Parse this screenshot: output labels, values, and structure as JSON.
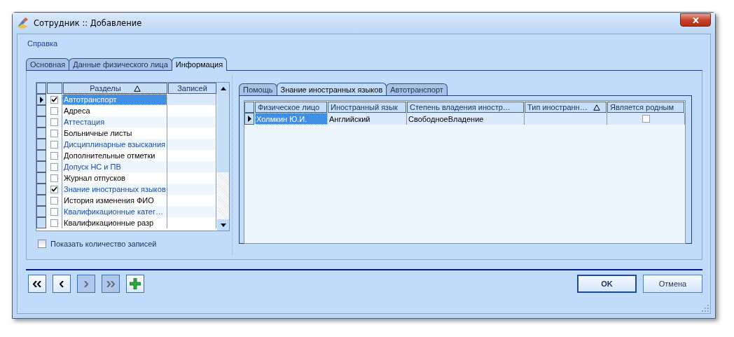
{
  "window": {
    "title": "Сотрудник :: Добавление"
  },
  "menu": [
    {
      "label": "Справка"
    }
  ],
  "tabs": [
    {
      "label": "Основная",
      "selected": false
    },
    {
      "label": "Данные физического лица",
      "selected": false
    },
    {
      "label": "Информация",
      "selected": true
    }
  ],
  "sections_grid": {
    "columns": [
      {
        "label": "Разделы",
        "sorted": true
      },
      {
        "label": "Записей",
        "sorted": false
      }
    ],
    "rows": [
      {
        "name": "Автотранспорт",
        "checked": true,
        "selected": true
      },
      {
        "name": "Адреса",
        "checked": false,
        "selected": false
      },
      {
        "name": "Аттестация",
        "checked": false,
        "selected": false
      },
      {
        "name": "Больничные листы",
        "checked": false,
        "selected": false
      },
      {
        "name": "Дисциплинарные взыскания",
        "checked": false,
        "selected": false
      },
      {
        "name": "Дополнительные отметки",
        "checked": false,
        "selected": false
      },
      {
        "name": "Допуск НС и ПВ",
        "checked": false,
        "selected": false
      },
      {
        "name": "Журнал отпусков",
        "checked": false,
        "selected": false
      },
      {
        "name": "Знание иностранных языков",
        "checked": true,
        "selected": false
      },
      {
        "name": "История изменения ФИО",
        "checked": false,
        "selected": false
      },
      {
        "name": "Квалификационные катег…",
        "checked": false,
        "selected": false
      },
      {
        "name": "Квалификационные разр",
        "checked": false,
        "selected": false
      }
    ]
  },
  "show_count": {
    "label": "Показать количество записей",
    "checked": false
  },
  "detail_tabs": [
    {
      "label": "Помощь",
      "selected": false
    },
    {
      "label": "Знание иностранных языков",
      "selected": true
    },
    {
      "label": "Автотранспорт",
      "selected": false
    }
  ],
  "detail_grid": {
    "columns": [
      {
        "label": "Физическое лицо",
        "sorted": false
      },
      {
        "label": "Иностранный язык",
        "sorted": false
      },
      {
        "label": "Степень владения иностр…",
        "sorted": false
      },
      {
        "label": "Тип иностранн…",
        "sorted": true
      },
      {
        "label": "Является родным",
        "sorted": false
      }
    ],
    "rows": [
      {
        "cells": [
          "Холмкин Ю.И.",
          "Английский",
          "СвободноеВладение",
          ""
        ],
        "native": false,
        "selected": true
      }
    ]
  },
  "nav_buttons": [
    {
      "kind": "first",
      "disabled": false
    },
    {
      "kind": "prev",
      "disabled": false
    },
    {
      "kind": "next",
      "disabled": true
    },
    {
      "kind": "last",
      "disabled": true
    },
    {
      "kind": "add",
      "disabled": false
    }
  ],
  "buttons": [
    {
      "label": "OK",
      "default": true
    },
    {
      "label": "Отмена",
      "default": false
    }
  ]
}
